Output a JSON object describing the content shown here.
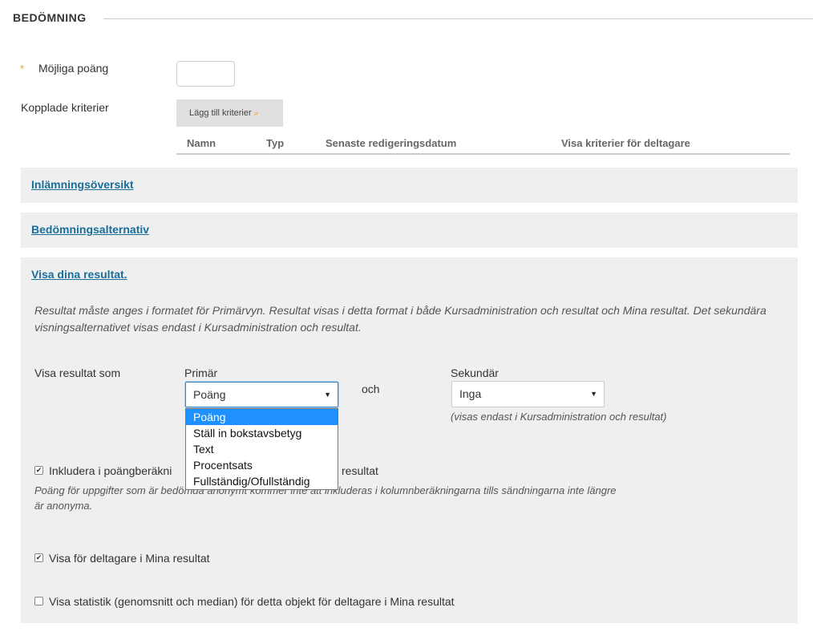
{
  "section": {
    "title": "BEDÖMNING"
  },
  "points": {
    "required_mark": "*",
    "label": "Möjliga poäng",
    "value": ""
  },
  "criteria": {
    "label": "Kopplade kriterier",
    "add_button": "Lägg till kriterier",
    "add_button_icon": "double-chevron-down-icon",
    "columns": [
      "Namn",
      "Typ",
      "Senaste redigeringsdatum",
      "Visa kriterier för deltagare"
    ]
  },
  "panels": {
    "submission_overview": "Inlämningsöversikt",
    "grading_options": "Bedömningsalternativ",
    "show_results": "Visa dina resultat."
  },
  "results": {
    "help": "Resultat måste anges i formatet för Primärvyn. Resultat visas i detta format i både Kursadministration och resultat och Mina resultat. Det sekundära visningsalternativet visas endast i Kursadministration och resultat.",
    "show_as_label": "Visa resultat som",
    "primary_label": "Primär",
    "primary_value": "Poäng",
    "and_label": "och",
    "secondary_label": "Sekundär",
    "secondary_value": "Inga",
    "secondary_note": "(visas endast i Kursadministration och resultat)",
    "primary_options": [
      "Poäng",
      "Ställ in bokstavsbetyg",
      "Text",
      "Procentsats",
      "Fullständig/Ofullständig"
    ],
    "selected_option_index": 0
  },
  "options": {
    "include_label_a": "Inkludera i poängberäkni",
    "include_label_b": "resultat",
    "include_checked": true,
    "include_note": "Poäng för uppgifter som är bedömda anonymt kommer inte att inkluderas i kolumnberäkningarna tills sändningarna inte längre är anonyma.",
    "visible_label": "Visa för deltagare i Mina resultat",
    "visible_checked": true,
    "stats_label": "Visa statistik (genomsnitt och median) för detta objekt för deltagare i Mina resultat",
    "stats_checked": false
  },
  "colors": {
    "link": "#1a6e99",
    "accent": "#e8a33c",
    "panel_bg": "#efefef",
    "highlight": "#1e90ff"
  }
}
